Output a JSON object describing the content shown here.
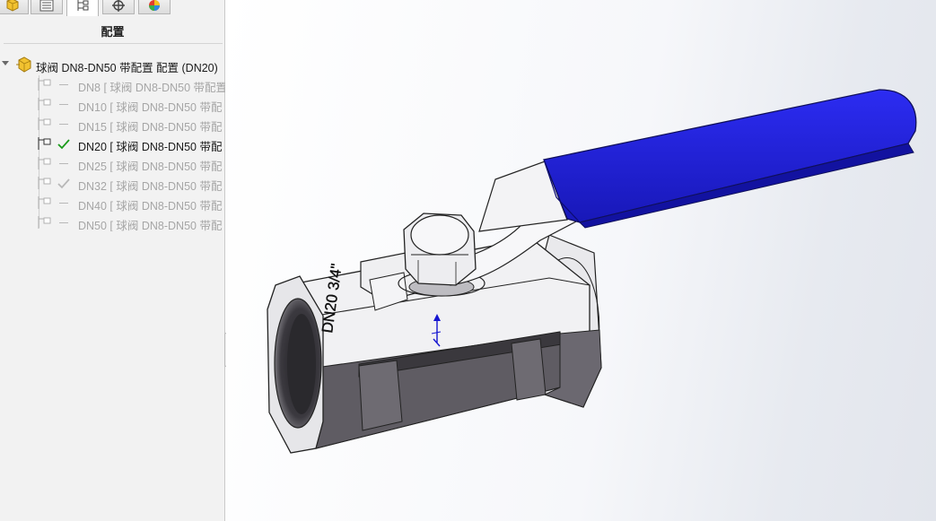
{
  "feature_manager": {
    "tabs": [
      {
        "name": "part-tab",
        "icon": "part-icon"
      },
      {
        "name": "property-tab",
        "icon": "property-manager-icon"
      },
      {
        "name": "configuration-tab",
        "icon": "configuration-manager-icon",
        "active": true
      },
      {
        "name": "dimxpert-tab",
        "icon": "dimxpert-icon"
      },
      {
        "name": "appearance-tab",
        "icon": "display-manager-icon"
      }
    ],
    "title": "配置",
    "root": {
      "label": "球阀 DN8-DN50 带配置 配置  (DN20)",
      "icon": "part-config-icon"
    },
    "configurations": [
      {
        "label": "DN8 [ 球阀 DN8-DN50 带配置",
        "mark": "dash",
        "active": false
      },
      {
        "label": "DN10 [ 球阀 DN8-DN50 带配",
        "mark": "dash",
        "active": false
      },
      {
        "label": "DN15 [ 球阀 DN8-DN50 带配",
        "mark": "dash",
        "active": false
      },
      {
        "label": "DN20 [ 球阀 DN8-DN50 带配",
        "mark": "check",
        "active": true
      },
      {
        "label": "DN25 [ 球阀 DN8-DN50 带配",
        "mark": "dash",
        "active": false
      },
      {
        "label": "DN32 [ 球阀 DN8-DN50 带配",
        "mark": "check-gray",
        "active": false
      },
      {
        "label": "DN40 [ 球阀 DN8-DN50 带配",
        "mark": "dash",
        "active": false
      },
      {
        "label": "DN50 [ 球阀 DN8-DN50 带配",
        "mark": "dash",
        "active": false
      }
    ]
  },
  "model": {
    "engraving": "DN20 3/4\"",
    "handle_color": "#2222e6",
    "body_color": "#5f5c63",
    "check_color": "#1a9a1a"
  }
}
